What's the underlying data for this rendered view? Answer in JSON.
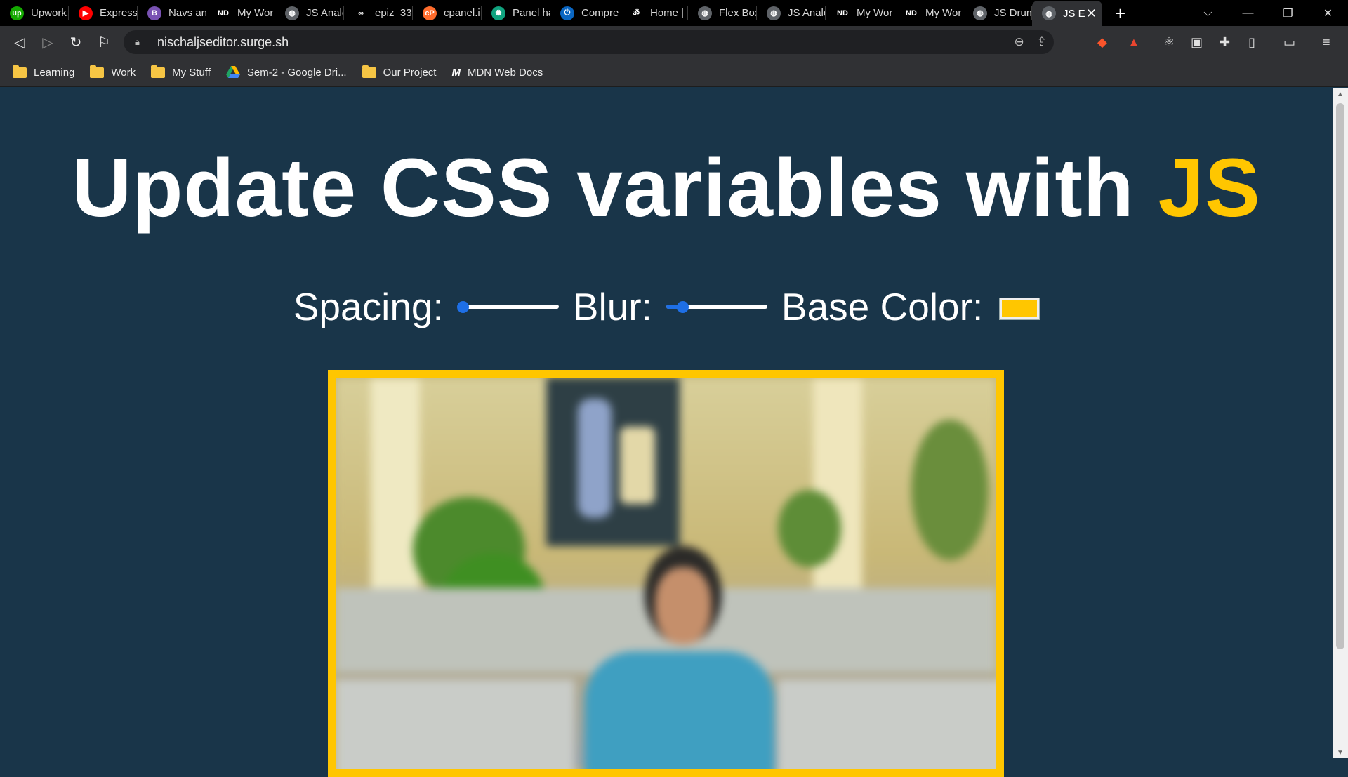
{
  "browser": {
    "tabs": [
      {
        "title": "Upwork",
        "icon": "upwork-icon",
        "color": "#14a800",
        "glyph": "up"
      },
      {
        "title": "Express",
        "icon": "youtube-icon",
        "color": "#ff0000",
        "glyph": "▶"
      },
      {
        "title": "Navs an",
        "icon": "bootstrap-icon",
        "color": "#7952b3",
        "glyph": "B"
      },
      {
        "title": "My Wor",
        "icon": "nd-icon",
        "color": "#000000",
        "glyph": "ND"
      },
      {
        "title": "JS Analo",
        "icon": "globe-icon",
        "color": "#5f6368",
        "glyph": "◍"
      },
      {
        "title": "epiz_33",
        "icon": "infinity-icon",
        "color": "#000000",
        "glyph": "∞"
      },
      {
        "title": "cpanel.i",
        "icon": "cpanel-icon",
        "color": "#ff6c2c",
        "glyph": "cP"
      },
      {
        "title": "Panel ha",
        "icon": "chatgpt-icon",
        "color": "#10a37f",
        "glyph": "✺"
      },
      {
        "title": "Compre",
        "icon": "power-icon",
        "color": "#0a66c2",
        "glyph": "⏻"
      },
      {
        "title": "Home |",
        "icon": "om-icon",
        "color": "#000000",
        "glyph": "ॐ"
      },
      {
        "title": "Flex Box",
        "icon": "globe-icon",
        "color": "#5f6368",
        "glyph": "◍"
      },
      {
        "title": "JS Analo",
        "icon": "globe-icon",
        "color": "#5f6368",
        "glyph": "◍"
      },
      {
        "title": "My Wor",
        "icon": "nd-icon",
        "color": "#000000",
        "glyph": "ND"
      },
      {
        "title": "My Wor",
        "icon": "nd-icon",
        "color": "#000000",
        "glyph": "ND"
      },
      {
        "title": "JS Drum",
        "icon": "globe-icon",
        "color": "#5f6368",
        "glyph": "◍"
      }
    ],
    "active_tab": {
      "title": "JS E",
      "icon": "globe-icon"
    },
    "url": "nischaljseditor.surge.sh",
    "bookmarks": [
      {
        "label": "Learning",
        "icon": "folder-icon"
      },
      {
        "label": "Work",
        "icon": "folder-icon"
      },
      {
        "label": "My Stuff",
        "icon": "folder-icon"
      },
      {
        "label": "Sem-2 - Google Dri...",
        "icon": "google-drive-icon"
      },
      {
        "label": "Our Project",
        "icon": "folder-icon"
      },
      {
        "label": "MDN Web Docs",
        "icon": "mdn-icon",
        "glyph": "M"
      }
    ]
  },
  "page": {
    "heading_main": "Update CSS variables with ",
    "heading_highlight": "JS",
    "controls": {
      "spacing_label": "Spacing:",
      "spacing_value_fraction": 0.05,
      "blur_label": "Blur:",
      "blur_value_fraction": 0.16,
      "base_color_label": "Base Color:",
      "base_color_value": "#ffc600"
    },
    "colors": {
      "background": "#193549",
      "accent": "#ffc600",
      "slider": "#1e6fe6"
    }
  }
}
